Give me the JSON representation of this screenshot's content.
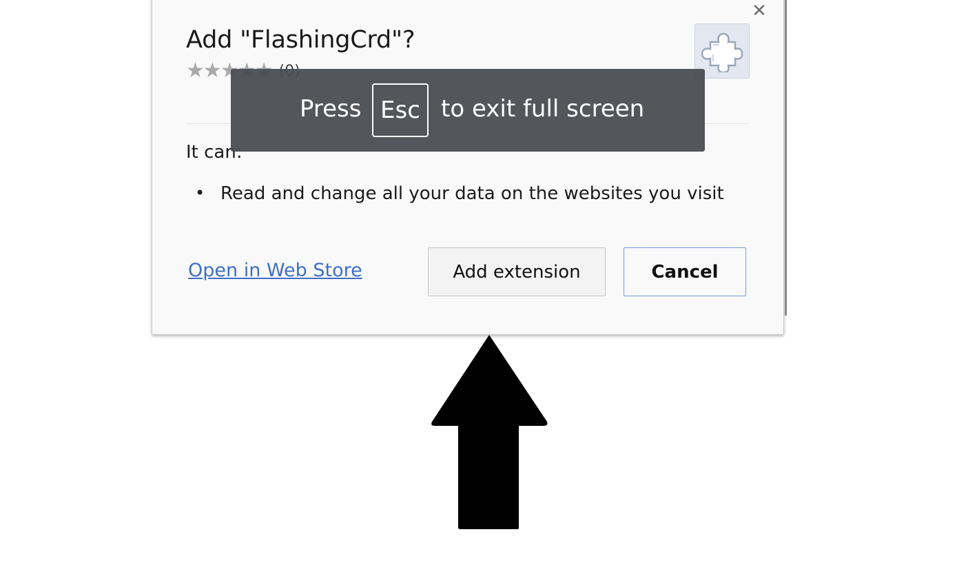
{
  "dialog": {
    "title": "Add \"FlashingCrd\"?",
    "rating_count": "(0)",
    "rating_stars": 0,
    "rating_max": 5,
    "icon": "puzzle-piece-icon",
    "close_icon": "close-icon",
    "permissions_heading": "It can:",
    "permissions": [
      "Read and change all your data on the websites you visit"
    ],
    "webstore_link": "Open in Web Store",
    "add_button": "Add extension",
    "cancel_button": "Cancel"
  },
  "fullscreen_bubble": {
    "prefix": "Press",
    "key": "Esc",
    "suffix": "to exit full screen"
  },
  "overlay": {
    "arrow_icon": "up-arrow-icon",
    "arrow_color": "#000000"
  },
  "colors": {
    "link": "#3f6fc6",
    "cancel_border": "#6f9be0",
    "bubble_background": "#4a4d52"
  }
}
